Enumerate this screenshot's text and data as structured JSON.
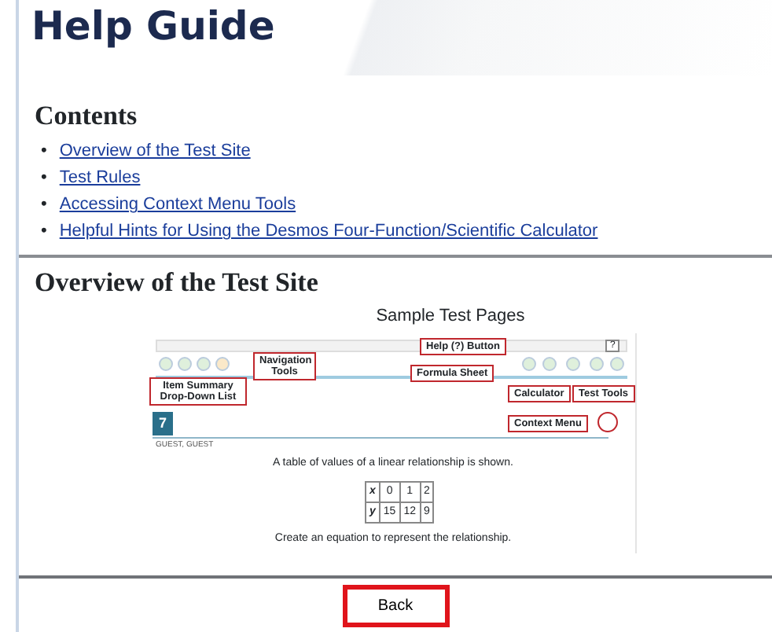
{
  "header": {
    "title": "Help Guide"
  },
  "contents": {
    "heading": "Contents",
    "links": [
      {
        "bullet": "•",
        "label": "Overview of the Test Site"
      },
      {
        "bullet": "•",
        "label": "Test Rules"
      },
      {
        "bullet": "•",
        "label": "Accessing Context Menu Tools"
      },
      {
        "bullet": "•",
        "label": "Helpful Hints for Using the Desmos Four-Function/Scientific Calculator"
      }
    ]
  },
  "overview": {
    "heading": "Overview of the Test Site",
    "caption": "Sample Test Pages",
    "sample": {
      "callouts": [
        {
          "label": "Help (?) Button"
        },
        {
          "label": "Navigation Tools"
        },
        {
          "label": "Formula Sheet"
        },
        {
          "label": "Item Summary Drop-Down List"
        },
        {
          "label": "Calculator"
        },
        {
          "label": "Test Tools"
        },
        {
          "label": "Context Menu"
        }
      ],
      "help_key": "?",
      "question_number": "7",
      "student": "GUEST, GUEST",
      "prompt": "A table of values of a linear relationship is shown.",
      "table": [
        [
          "x",
          "0",
          "1",
          "2"
        ],
        [
          "y",
          "15",
          "12",
          "9"
        ]
      ],
      "instruction": "Create an equation to represent the relationship."
    }
  },
  "footer": {
    "button": "Back"
  }
}
